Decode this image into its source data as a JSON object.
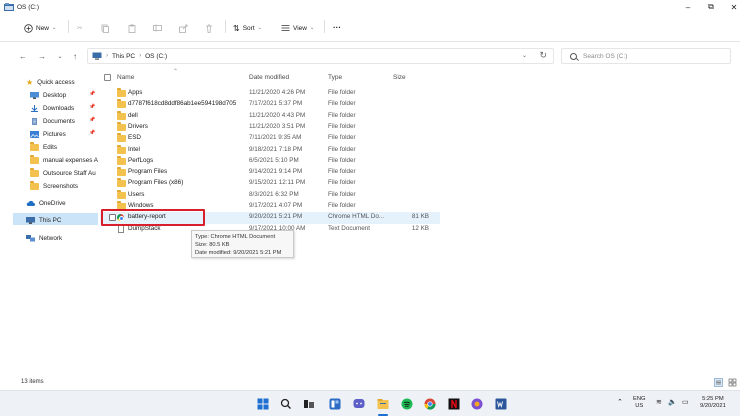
{
  "window": {
    "title": "OS (C:)",
    "controls": {
      "minimize": "–",
      "maximize": "⧉",
      "close": "✕"
    }
  },
  "toolbar": {
    "new_label": "New",
    "sort_label": "Sort",
    "view_label": "View",
    "more_label": "···"
  },
  "address": {
    "crumbs": [
      "This PC",
      "OS (C:)"
    ],
    "search_placeholder": "Search OS (C:)"
  },
  "sidebar": {
    "quick_access": "Quick access",
    "items": [
      {
        "label": "Desktop",
        "icon": "desktop-icon",
        "pinned": true
      },
      {
        "label": "Downloads",
        "icon": "download-icon",
        "pinned": true
      },
      {
        "label": "Documents",
        "icon": "documents-icon",
        "pinned": true
      },
      {
        "label": "Pictures",
        "icon": "pictures-icon",
        "pinned": true
      },
      {
        "label": "Edits",
        "icon": "folder-icon",
        "pinned": false
      },
      {
        "label": "manual expenses A",
        "icon": "folder-icon",
        "pinned": false
      },
      {
        "label": "Outsource Staff Au",
        "icon": "folder-icon",
        "pinned": false
      },
      {
        "label": "Screenshots",
        "icon": "folder-icon",
        "pinned": false
      }
    ],
    "onedrive": "OneDrive",
    "this_pc": "This PC",
    "network": "Network"
  },
  "columns": {
    "name": "Name",
    "date": "Date modified",
    "type": "Type",
    "size": "Size"
  },
  "files": [
    {
      "name": "Apps",
      "date": "11/21/2020 4:26 PM",
      "type": "File folder",
      "size": "",
      "kind": "folder"
    },
    {
      "name": "d7787f618cd8ddf86ab1ee594198d705",
      "date": "7/17/2021 5:37 PM",
      "type": "File folder",
      "size": "",
      "kind": "folder"
    },
    {
      "name": "dell",
      "date": "11/21/2020 4:43 PM",
      "type": "File folder",
      "size": "",
      "kind": "folder"
    },
    {
      "name": "Drivers",
      "date": "11/21/2020 3:51 PM",
      "type": "File folder",
      "size": "",
      "kind": "folder"
    },
    {
      "name": "ESD",
      "date": "7/11/2021 9:35 AM",
      "type": "File folder",
      "size": "",
      "kind": "folder"
    },
    {
      "name": "Intel",
      "date": "9/18/2021 7:18 PM",
      "type": "File folder",
      "size": "",
      "kind": "folder"
    },
    {
      "name": "PerfLogs",
      "date": "6/5/2021 5:10 PM",
      "type": "File folder",
      "size": "",
      "kind": "folder"
    },
    {
      "name": "Program Files",
      "date": "9/14/2021 9:14 PM",
      "type": "File folder",
      "size": "",
      "kind": "folder"
    },
    {
      "name": "Program Files (x86)",
      "date": "9/15/2021 12:11 PM",
      "type": "File folder",
      "size": "",
      "kind": "folder"
    },
    {
      "name": "Users",
      "date": "8/3/2021 6:32 PM",
      "type": "File folder",
      "size": "",
      "kind": "folder"
    },
    {
      "name": "Windows",
      "date": "9/17/2021 4:07 PM",
      "type": "File folder",
      "size": "",
      "kind": "folder"
    },
    {
      "name": "battery-report",
      "date": "9/20/2021 5:21 PM",
      "type": "Chrome HTML Do...",
      "size": "81 KB",
      "kind": "chrome"
    },
    {
      "name": "DumpStack",
      "date": "9/17/2021 10:00 AM",
      "type": "Text Document",
      "size": "12 KB",
      "kind": "text"
    }
  ],
  "tooltip": {
    "type_line": "Type: Chrome HTML Document",
    "size_line": "Size: 80.5 KB",
    "date_line": "Date modified: 9/20/2021 5:21 PM"
  },
  "status": {
    "item_count": "13 items"
  },
  "taskbar": {
    "lang_top": "ENG",
    "lang_bottom": "US",
    "time": "5:25 PM",
    "date": "9/20/2021"
  },
  "colors": {
    "highlight": "#d8202d",
    "selection": "#cce4f7",
    "folder": "#f2c14e",
    "taskbar": "#eef1f6"
  }
}
